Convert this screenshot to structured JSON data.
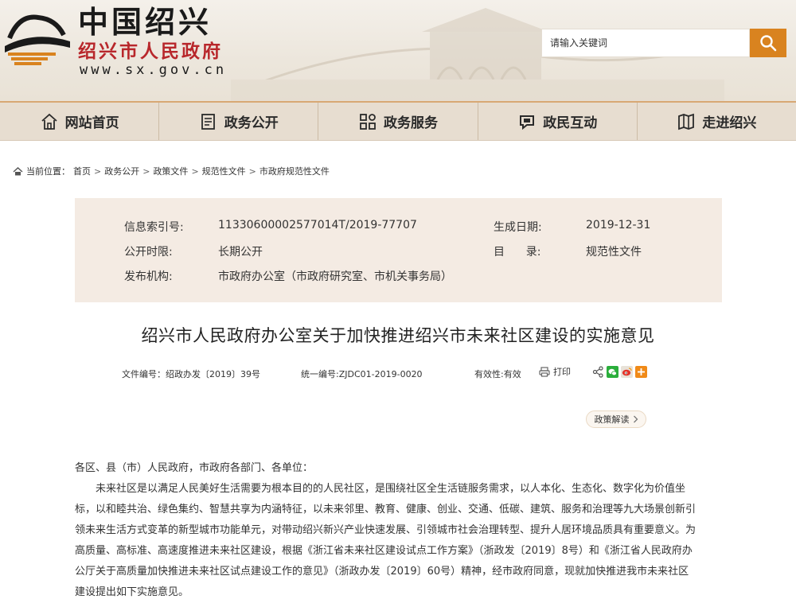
{
  "header": {
    "logo_main": "中国绍兴",
    "logo_sub": "绍兴市人民政府",
    "logo_url": "www.sx.gov.cn",
    "search_placeholder": "请输入关键词",
    "search_icon": "search-icon",
    "accent_color": "#d9831f"
  },
  "nav": {
    "items": [
      {
        "label": "网站首页",
        "icon": "home-icon"
      },
      {
        "label": "政务公开",
        "icon": "document-icon"
      },
      {
        "label": "政务服务",
        "icon": "grid-icon"
      },
      {
        "label": "政民互动",
        "icon": "chat-icon"
      },
      {
        "label": "走进绍兴",
        "icon": "map-icon"
      }
    ]
  },
  "breadcrumb": {
    "prefix": "当前位置：",
    "items": [
      "首页",
      "政务公开",
      "政策文件",
      "规范性文件",
      "市政府规范性文件"
    ],
    "separator": ">"
  },
  "info": {
    "index_label": "信息索引号:",
    "index_value": "11330600002577014T/2019-77707",
    "date_label": "生成日期:",
    "date_value": "2019-12-31",
    "period_label": "公开时限:",
    "period_value": "长期公开",
    "catalog_label": "目      录:",
    "catalog_value": "规范性文件",
    "publisher_label": "发布机构:",
    "publisher_value": "市政府办公室（市政府研究室、市机关事务局）"
  },
  "document": {
    "title": "绍兴市人民政府办公室关于加快推进绍兴市未来社区建设的实施意见",
    "doc_number": "文件编号：绍政办发〔2019〕39号",
    "unified_number": "统一编号:ZJDC01-2019-0020",
    "validity": "有效性:有效",
    "print_label": "打印",
    "policy_button": "政策解读",
    "salutation": "各区、县（市）人民政府，市政府各部门、各单位：",
    "paragraph_lines": [
      "未来社区是以满足人民美好生活需要为根本目的的人民社区，是围绕社区全生活链服务需求，以人本化、生态化、数字化为价值坐",
      "标，以和睦共治、绿色集约、智慧共享为内涵特征，以未来邻里、教育、健康、创业、交通、低碳、建筑、服务和治理等九大场景创新引",
      "领未来生活方式变革的新型城市功能单元，对带动绍兴新兴产业快速发展、引领城市社会治理转型、提升人居环境品质具有重要意义。为",
      "高质量、高标准、高速度推进未来社区建设，根据《浙江省未来社区建设试点工作方案》（浙政发〔2019〕8号）和《浙江省人民政府办",
      "公厅关于高质量加快推进未来社区试点建设工作的意见》（浙政办发〔2019〕60号）精神，经市政府同意，现就加快推进我市未来社区",
      "建设提出如下实施意见。"
    ]
  },
  "colors": {
    "info_bg": "#f4ebe3",
    "nav_bg": "#e7ddd0",
    "logo_red": "#b8272b"
  }
}
